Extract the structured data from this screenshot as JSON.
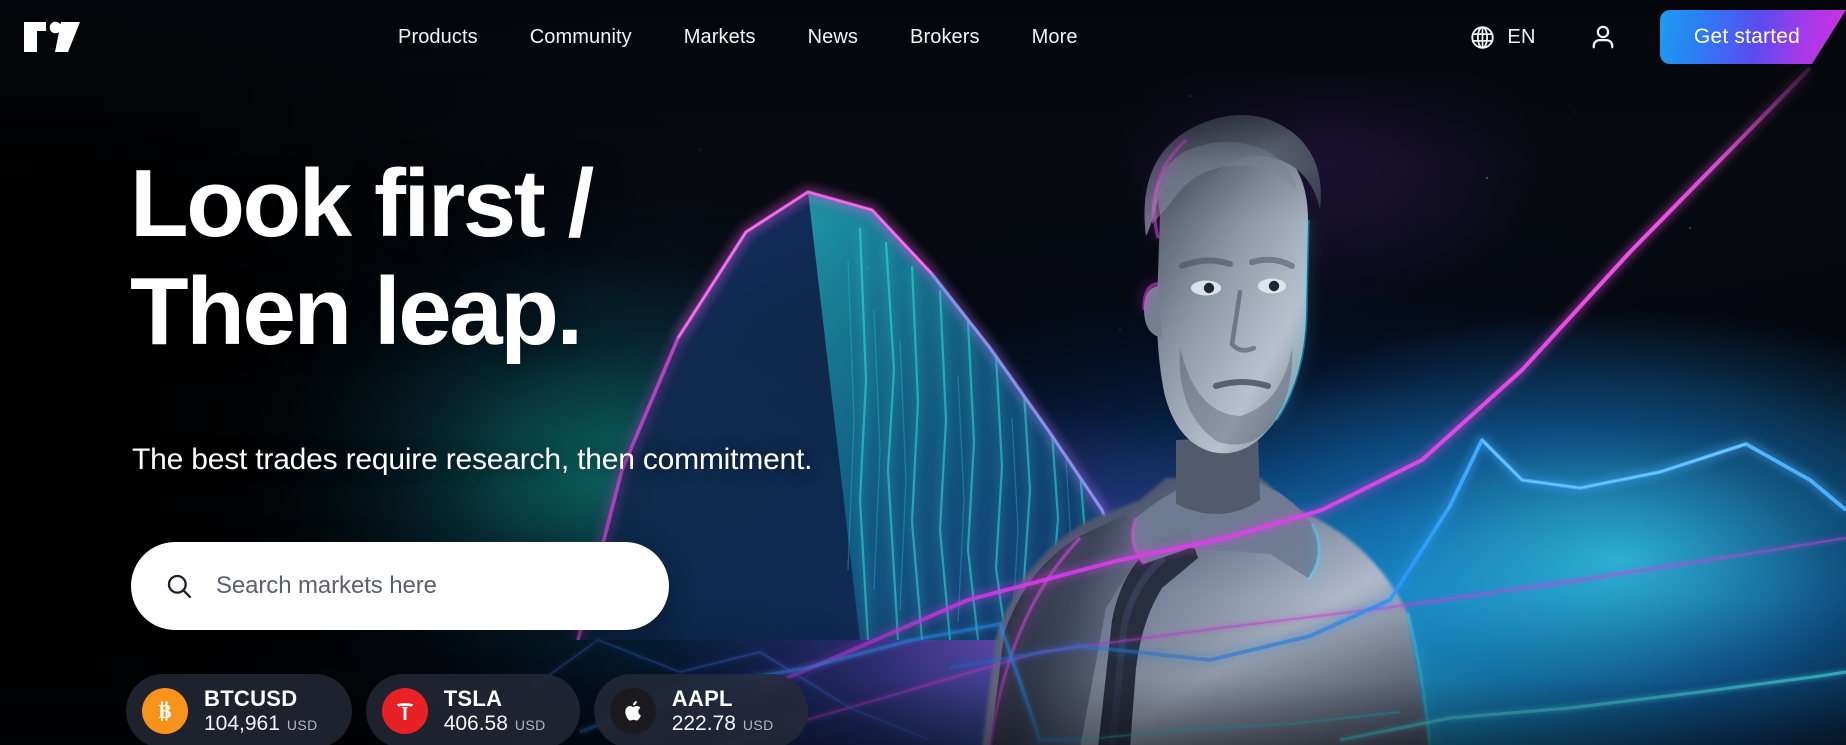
{
  "brand": {
    "name": "TradingView",
    "logo_icon": "tradingview-logo-icon"
  },
  "header": {
    "nav_items": [
      {
        "label": "Products",
        "name": "nav-products"
      },
      {
        "label": "Community",
        "name": "nav-community"
      },
      {
        "label": "Markets",
        "name": "nav-markets"
      },
      {
        "label": "News",
        "name": "nav-news"
      },
      {
        "label": "Brokers",
        "name": "nav-brokers"
      },
      {
        "label": "More",
        "name": "nav-more"
      }
    ],
    "language": {
      "code": "EN",
      "icon": "globe-icon"
    },
    "account": {
      "icon": "user-account-icon"
    },
    "cta": {
      "label": "Get started",
      "gradient_from": "#1e9cf0",
      "gradient_to": "#d430e0"
    }
  },
  "hero": {
    "headline_line1": "Look first /",
    "headline_line2": "Then leap.",
    "subheadline": "The best trades require research, then commitment.",
    "search": {
      "value": "",
      "placeholder": "Search markets here",
      "icon": "search-icon"
    }
  },
  "tickers": [
    {
      "symbol": "BTCUSD",
      "price": "104,961",
      "currency": "USD",
      "logo_icon": "bitcoin-icon",
      "logo_color": "#f7931a"
    },
    {
      "symbol": "TSLA",
      "price": "406.58",
      "currency": "USD",
      "logo_icon": "tesla-icon",
      "logo_color": "#e82127"
    },
    {
      "symbol": "AAPL",
      "price": "222.78",
      "currency": "USD",
      "logo_icon": "apple-icon",
      "logo_color": "#1b1b1f"
    }
  ],
  "artwork": {
    "description": "night-mountain-hiker-with-neon-chart-lines",
    "accent_cyan": "#2ed6ff",
    "accent_magenta": "#d430e0",
    "accent_blue": "#2a7ef5"
  }
}
